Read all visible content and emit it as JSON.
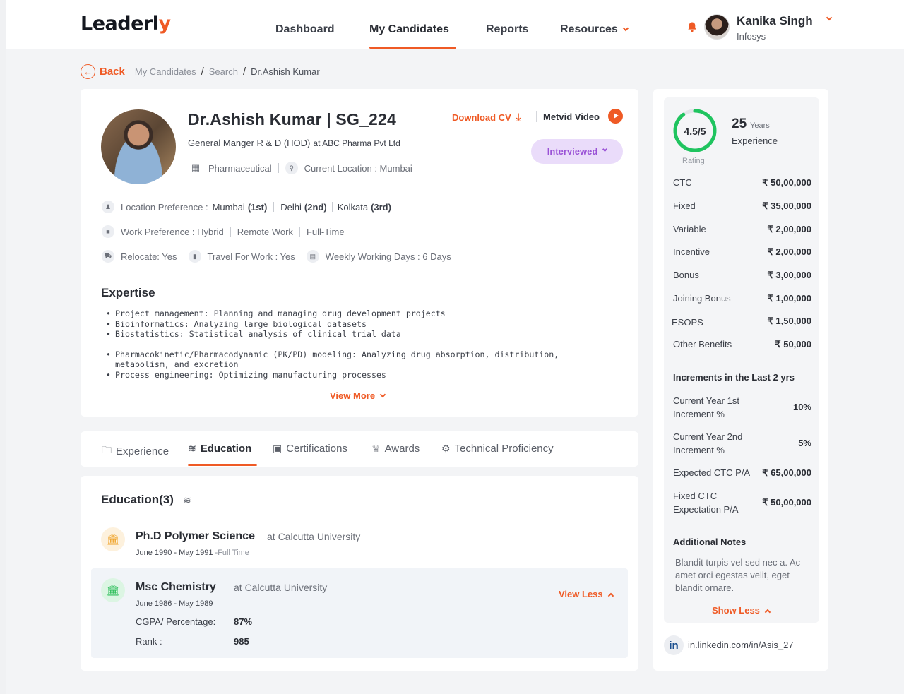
{
  "brand": {
    "logo_main": "Leaderl",
    "logo_accent": "y"
  },
  "nav": {
    "items": [
      {
        "label": "Dashboard"
      },
      {
        "label": "My Candidates"
      },
      {
        "label": "Reports"
      },
      {
        "label": "Resources"
      }
    ]
  },
  "user": {
    "name": "Kanika Singh",
    "org": "Infosys"
  },
  "breadcrumb": {
    "back": "Back",
    "items": [
      "My Candidates",
      "Search",
      "Dr.Ashish Kumar"
    ]
  },
  "candidate": {
    "name": "Dr.Ashish Kumar  | SG_224",
    "title": "General Manger R & D (HOD)",
    "company": "at ABC Pharma Pvt Ltd",
    "industry": "Pharmaceutical",
    "current_location": "Current Location : Mumbai",
    "download_cv": "Download CV",
    "metvid": "Metvid  Video",
    "status": "Interviewed",
    "location_pref_label": "Location Preference :",
    "location_prefs": [
      {
        "city": "Mumbai",
        "rank": "(1st)"
      },
      {
        "city": "Delhi",
        "rank": "(2nd)"
      },
      {
        "city": "Kolkata",
        "rank": "(3rd)"
      }
    ],
    "work_pref_label": "Work Preference : Hybrid",
    "work_prefs": [
      "Remote Work",
      "Full-Time"
    ],
    "relocate": "Relocate: Yes",
    "travel": "Travel For Work  : Yes",
    "working_days": "Weekly Working Days : 6 Days"
  },
  "expertise": {
    "heading": "Expertise",
    "items": [
      "Project management: Planning and managing drug development projects",
      "Bioinformatics: Analyzing large biological datasets",
      "Biostatistics: Statistical analysis of clinical trial data",
      "Pharmacokinetic/Pharmacodynamic (PK/PD) modeling: Analyzing drug absorption, distribution, metabolism, and excretion",
      "Process engineering: Optimizing manufacturing processes"
    ],
    "view_more": "View More"
  },
  "tabs": [
    {
      "label": "Experience",
      "icon": "briefcase-icon"
    },
    {
      "label": "Education",
      "icon": "graduation-cap-icon"
    },
    {
      "label": "Certifications",
      "icon": "certificate-icon"
    },
    {
      "label": "Awards",
      "icon": "trophy-icon"
    },
    {
      "label": "Technical Proficiency",
      "icon": "gear-icon"
    }
  ],
  "education": {
    "title": "Education(3)",
    "entries": [
      {
        "degree": "Ph.D Polymer Science",
        "at": "at Calcutta University",
        "dates": "June 1990 - May 1991",
        "type": "-Full Time"
      },
      {
        "degree": "Msc Chemistry",
        "at": "at Calcutta University",
        "dates": "June 1986 - May 1989",
        "cgpa_label": "CGPA/ Percentage:",
        "cgpa": "87%",
        "rank_label": "Rank :",
        "rank": "985"
      }
    ],
    "view_less": "View Less"
  },
  "summary": {
    "rating": "4.5/5",
    "rating_value": 4.5,
    "rating_max": 5,
    "rating_label": "Rating",
    "experience_years": "25",
    "experience_unit": "Years",
    "experience_label": "Experience",
    "compensation": [
      {
        "label": "CTC",
        "value": "₹ 50,00,000"
      },
      {
        "label": "Fixed",
        "value": "₹ 35,00,000"
      },
      {
        "label": "Variable",
        "value": "₹ 2,00,000"
      },
      {
        "label": "Incentive",
        "value": "₹ 2,00,000"
      },
      {
        "label": "Bonus",
        "value": "₹ 3,00,000"
      },
      {
        "label": "Joining Bonus",
        "value": "₹ 1,00,000"
      },
      {
        "label": "ESOPS",
        "value": "₹ 1,50,000"
      },
      {
        "label": "Other Benefits",
        "value": "₹ 50,000"
      }
    ],
    "increments_heading": "Increments in the Last 2 yrs",
    "increments": [
      {
        "label": "Current Year 1st Increment %",
        "value": "10%"
      },
      {
        "label": "Current Year 2nd Increment %",
        "value": "5%"
      }
    ],
    "expected_ctc_label": "Expected CTC P/A",
    "expected_ctc": "₹ 65,00,000",
    "fixed_ctc_label": "Fixed CTC Expectation P/A",
    "fixed_ctc": "₹ 50,00,000",
    "notes_heading": "Additional Notes",
    "notes": "Blandit turpis vel sed nec a. Ac amet orci egestas velit, eget blandit ornare.",
    "show_less": "Show Less",
    "linkedin": "in.linkedin.com/in/Asis_27"
  },
  "colors": {
    "accent": "#ef5a25",
    "rating_ring": "#1fc45f",
    "status_bg": "#eadcfa",
    "status_text": "#9a52d6"
  }
}
